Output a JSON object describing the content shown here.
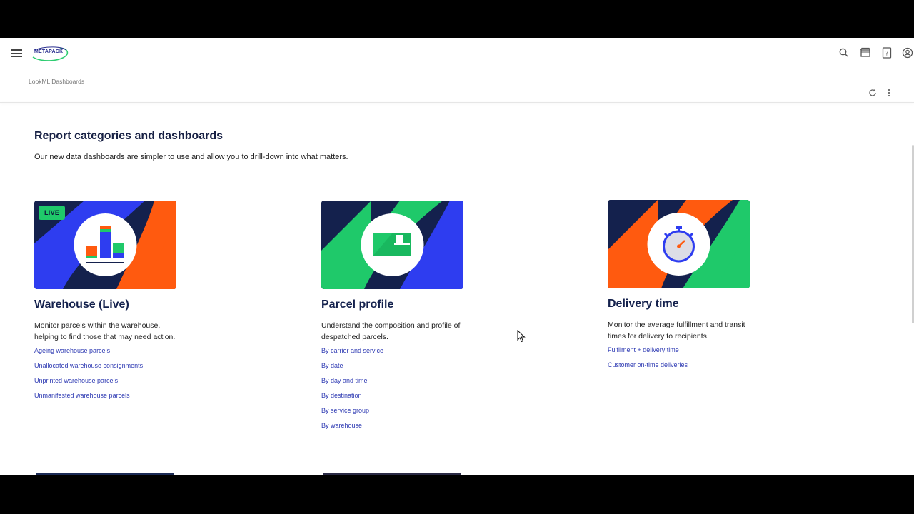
{
  "app": {
    "logo_text": "METAPACK",
    "breadcrumb": "LookML Dashboards",
    "icons": [
      "menu-icon",
      "search-icon",
      "marketplace-icon",
      "help-icon",
      "account-icon",
      "refresh-icon",
      "more-vert-icon"
    ]
  },
  "page": {
    "title": "Report categories and dashboards",
    "subtitle": "Our new data dashboards are simpler to use and allow you to drill-down into what matters."
  },
  "cards": [
    {
      "badge": "LIVE",
      "title": "Warehouse (Live)",
      "description": "Monitor parcels within the warehouse, helping to find those that may need action.",
      "links": [
        "Ageing warehouse parcels",
        "Unallocated warehouse consignments",
        "Unprinted warehouse parcels",
        "Unmanifested warehouse parcels"
      ]
    },
    {
      "title": "Parcel profile",
      "description": "Understand the composition and profile of despatched parcels.",
      "links": [
        "By carrier and service",
        "By date",
        "By day and time",
        "By destination",
        "By service group",
        "By warehouse"
      ]
    },
    {
      "title": "Delivery time",
      "description": "Monitor the average fulfillment and transit times for delivery to recipients.",
      "links": [
        "Fulfilment + delivery time",
        "Customer on-time deliveries"
      ]
    }
  ],
  "colors": {
    "navy": "#14214d",
    "orange": "#ff5a0f",
    "green": "#1fc96a",
    "blue": "#2e3df0",
    "link": "#2f3bb3"
  }
}
